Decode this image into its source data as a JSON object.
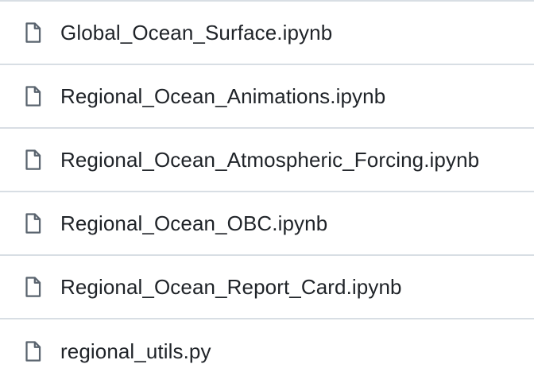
{
  "files": [
    {
      "name": "Global_Ocean_Surface.ipynb",
      "icon": "file-icon"
    },
    {
      "name": "Regional_Ocean_Animations.ipynb",
      "icon": "file-icon"
    },
    {
      "name": "Regional_Ocean_Atmospheric_Forcing.ipynb",
      "icon": "file-icon"
    },
    {
      "name": "Regional_Ocean_OBC.ipynb",
      "icon": "file-icon"
    },
    {
      "name": "Regional_Ocean_Report_Card.ipynb",
      "icon": "file-icon"
    },
    {
      "name": "regional_utils.py",
      "icon": "file-icon"
    }
  ],
  "colors": {
    "text": "#1f2328",
    "icon": "#59636e",
    "divider": "#d8dee4",
    "background": "#ffffff"
  }
}
